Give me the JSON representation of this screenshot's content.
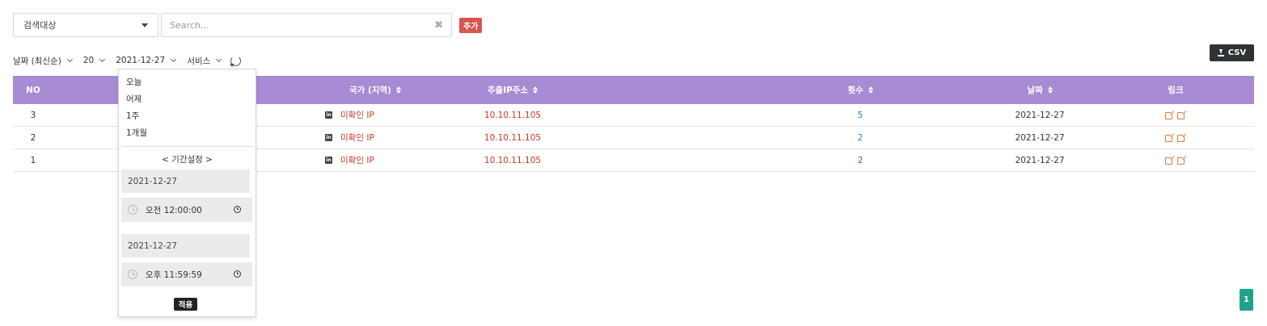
{
  "search": {
    "target_select": "검색대상",
    "placeholder": "Search...",
    "value": "",
    "add_label": "추가"
  },
  "filters": {
    "sort": "날짜 (최신순)",
    "page_size": "20",
    "date": "2021-12-27",
    "service": "서비스"
  },
  "csv_label": "CSV",
  "table": {
    "headers": {
      "no": "NO",
      "country": "국가 (지역)",
      "ip": "추출IP주소",
      "count": "횟수",
      "date": "날짜",
      "link": "링크"
    },
    "rows": [
      {
        "no": "3",
        "country": "미확인 IP",
        "ip": "10.10.11.105",
        "count": "5",
        "date": "2021-12-27"
      },
      {
        "no": "2",
        "country": "미확인 IP",
        "ip": "10.10.11.105",
        "count": "2",
        "date": "2021-12-27"
      },
      {
        "no": "1",
        "country": "미확인 IP",
        "ip": "10.10.11.105",
        "count": "2",
        "date": "2021-12-27"
      }
    ]
  },
  "date_dropdown": {
    "presets": [
      "오늘",
      "어제",
      "1주",
      "1개월"
    ],
    "period_label": "< 기간설정 >",
    "start_date": "2021-12-27",
    "start_time": "오전 12:00:00",
    "end_date": "2021-12-27",
    "end_time": "오후 11:59:59",
    "apply_label": "적용"
  },
  "pagination": {
    "current": "1"
  },
  "colors": {
    "header_bg": "#a78bd4",
    "add_button": "#d9534f",
    "ip_text": "#c0392b",
    "count_text": "#2a7ab7",
    "link_icon": "#e07b39",
    "page_button": "#1fa38a"
  }
}
